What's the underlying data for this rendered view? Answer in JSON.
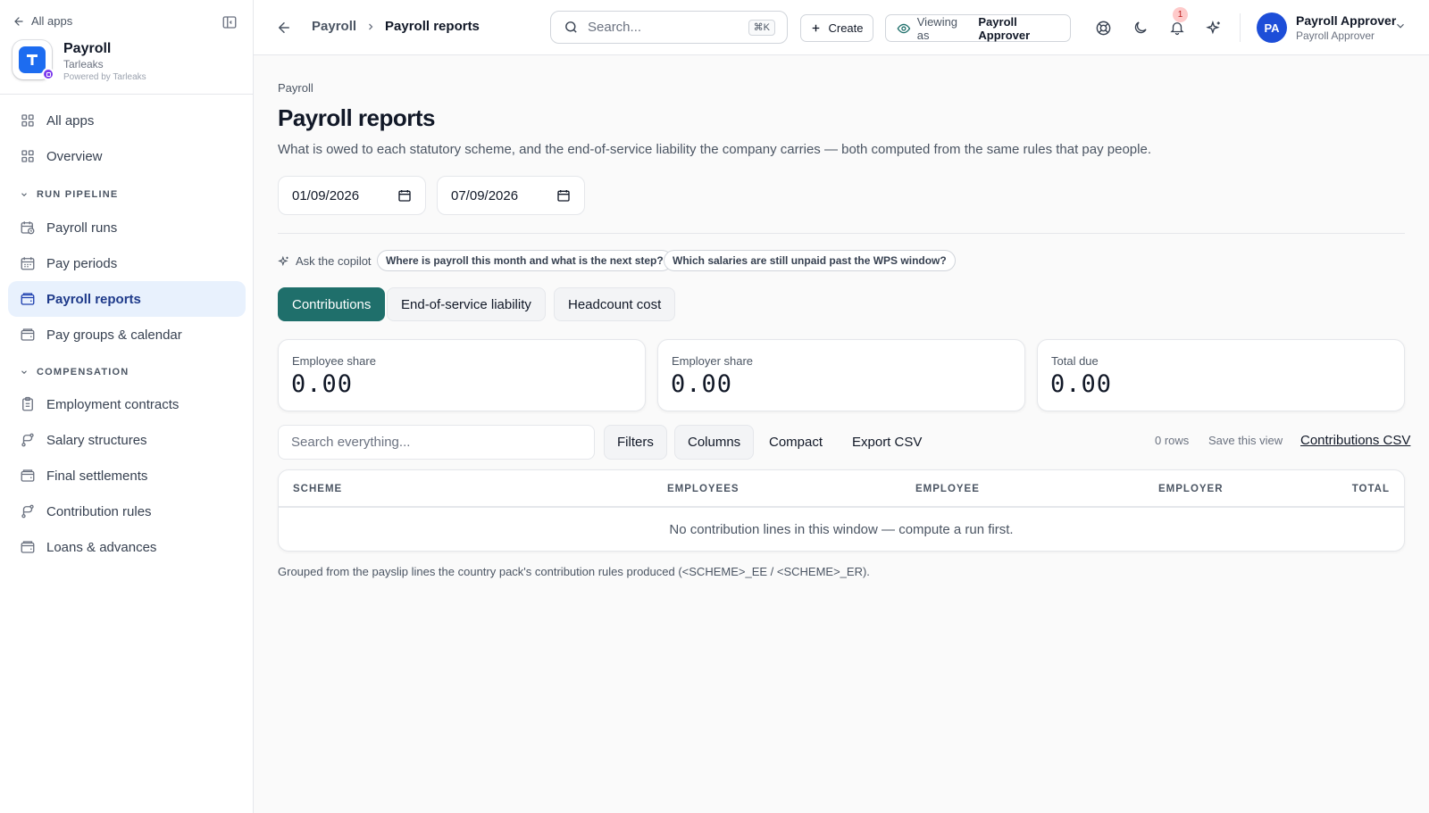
{
  "sidebar": {
    "all_apps_link": "All apps",
    "app": {
      "name": "Payroll",
      "org": "Tarleaks",
      "powered_by": "Powered by Tarleaks"
    },
    "nav": {
      "all_apps": "All apps",
      "overview": "Overview",
      "section_run_pipeline": "RUN PIPELINE",
      "payroll_runs": "Payroll runs",
      "pay_periods": "Pay periods",
      "payroll_reports": "Payroll reports",
      "pay_groups": "Pay groups & calendar",
      "section_compensation": "COMPENSATION",
      "employment_contracts": "Employment contracts",
      "salary_structures": "Salary structures",
      "final_settlements": "Final settlements",
      "contribution_rules": "Contribution rules",
      "loans_advances": "Loans & advances"
    }
  },
  "topbar": {
    "breadcrumb": {
      "parent": "Payroll",
      "current": "Payroll reports"
    },
    "search": {
      "placeholder": "Search...",
      "shortcut": "⌘K"
    },
    "create_label": "Create",
    "viewing_as_label": "Viewing as",
    "viewing_as_role": "Payroll Approver",
    "notification_count": "1",
    "user": {
      "initials": "PA",
      "name": "Payroll Approver",
      "role": "Payroll Approver"
    }
  },
  "page": {
    "eyebrow": "Payroll",
    "title": "Payroll reports",
    "description": "What is owed to each statutory scheme, and the end-of-service liability the company carries — both computed from the same rules that pay people.",
    "date_from": "01/09/2026",
    "date_to": "07/09/2026",
    "copilot": {
      "label": "Ask the copilot",
      "suggestions": [
        "Where is payroll this month and what is the next step?",
        "Which salaries are still unpaid past the WPS window?"
      ]
    },
    "tabs": [
      "Contributions",
      "End-of-service liability",
      "Headcount cost"
    ],
    "active_tab": "Contributions",
    "kpis": [
      {
        "label": "Employee share",
        "value": "0.00"
      },
      {
        "label": "Employer share",
        "value": "0.00"
      },
      {
        "label": "Total due",
        "value": "0.00"
      }
    ],
    "toolbar": {
      "search_placeholder": "Search everything...",
      "filters": "Filters",
      "columns": "Columns",
      "compact": "Compact",
      "export_csv": "Export CSV",
      "rows_count": "0 rows",
      "save_view": "Save this view",
      "csv_link": "Contributions CSV"
    },
    "table": {
      "columns": [
        "SCHEME",
        "EMPLOYEES",
        "EMPLOYEE",
        "EMPLOYER",
        "TOTAL"
      ],
      "rows": [],
      "empty_message": "No contribution lines in this window — compute a run first."
    },
    "footnote": "Grouped from the payslip lines the country pack's contribution rules produced (<SCHEME>_EE / <SCHEME>_ER)."
  },
  "colors": {
    "accent": "#1f6f6b",
    "active_nav_bg": "#e8f1fd",
    "brand_blue": "#1d6cf0"
  }
}
